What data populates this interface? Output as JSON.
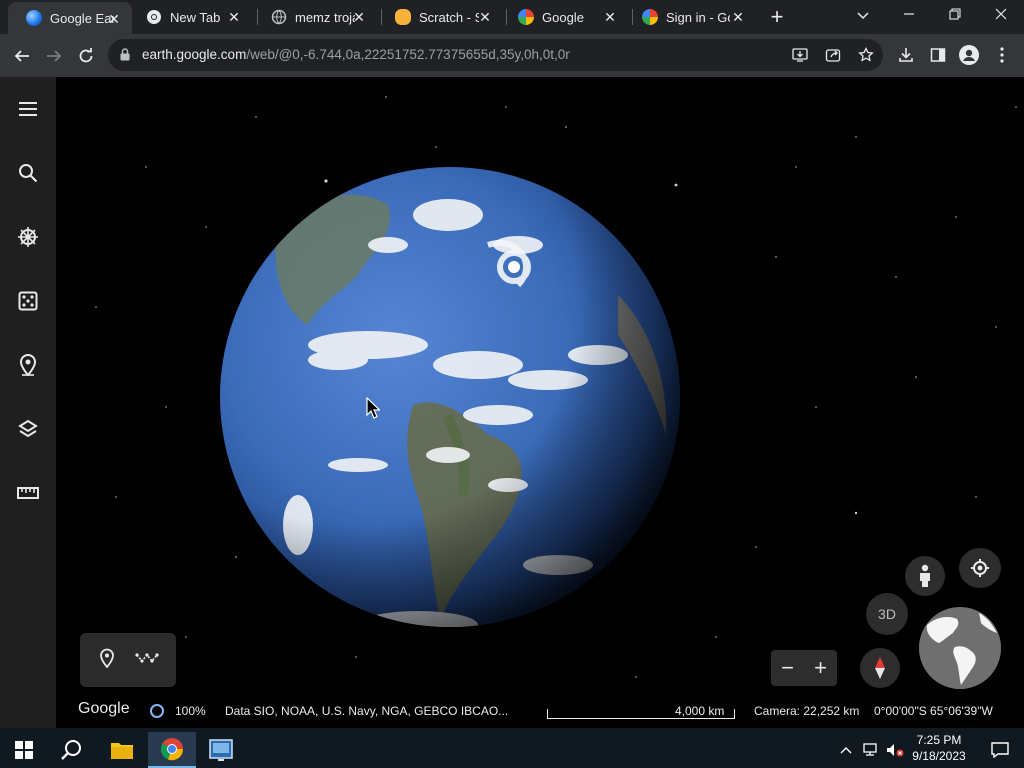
{
  "browser": {
    "tabs": [
      {
        "title": "Google Earth",
        "favicon": "google-earth-icon",
        "active": true
      },
      {
        "title": "New Tab",
        "favicon": "chrome-icon",
        "active": false
      },
      {
        "title": "memz trojan",
        "favicon": "web-globe-icon",
        "active": false
      },
      {
        "title": "Scratch - Search",
        "favicon": "scratch-icon",
        "active": false
      },
      {
        "title": "Google",
        "favicon": "google-g-icon",
        "active": false
      },
      {
        "title": "Sign in - Google",
        "favicon": "google-g-icon",
        "active": false
      }
    ],
    "address_host": "earth.google.com",
    "address_path": "/web/@0,-6.744,0a,22251752.77375655d,35y,0h,0t,0r"
  },
  "earth": {
    "brand": "Google",
    "loading_percent": "100%",
    "data_credits": "Data SIO, NOAA, U.S. Navy, NGA, GEBCO  IBCAO...",
    "scale_label": "4,000 km",
    "camera": "Camera: 22,252 km",
    "coordinates": "0°00'00\"S 65°06'39\"W",
    "view_mode_label": "3D",
    "zoom_out_label": "−",
    "zoom_in_label": "+"
  },
  "taskbar": {
    "time": "7:25 PM",
    "date": "9/18/2023"
  },
  "colors": {
    "tab_bg": "#202124",
    "toolbar_bg": "#35363a",
    "rail_bg": "#1f1f1f",
    "ocean": "#3a6bb8"
  }
}
